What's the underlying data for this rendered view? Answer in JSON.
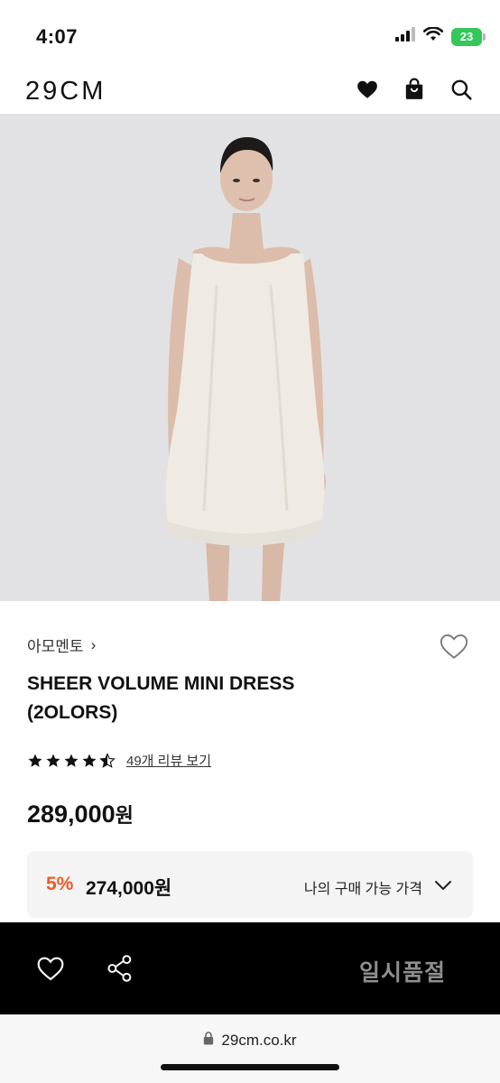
{
  "status_bar": {
    "time": "4:07",
    "battery": "23"
  },
  "header": {
    "logo": "29CM",
    "icons": [
      "heart-icon",
      "shopping-bag-icon",
      "search-icon"
    ]
  },
  "product": {
    "image_label": "product-photo",
    "brand": "아모멘토",
    "brand_chevron": "›",
    "title_line1": "SHEER VOLUME MINI DRESS",
    "title_line2": "(2OLORS)",
    "rating": 4.5,
    "review_link": "49개 리뷰 보기",
    "price": "289,000",
    "price_unit": "원",
    "discount_rate": "5%",
    "discount_price": "274,000원",
    "my_price_label": "나의 구매 가능 가격"
  },
  "bottom_bar": {
    "soldout_label": "일시품절"
  },
  "browser": {
    "url": "29cm.co.kr"
  },
  "colors": {
    "accent": "#ee5a28",
    "bar": "#000000",
    "muted": "#8e8e8e"
  }
}
